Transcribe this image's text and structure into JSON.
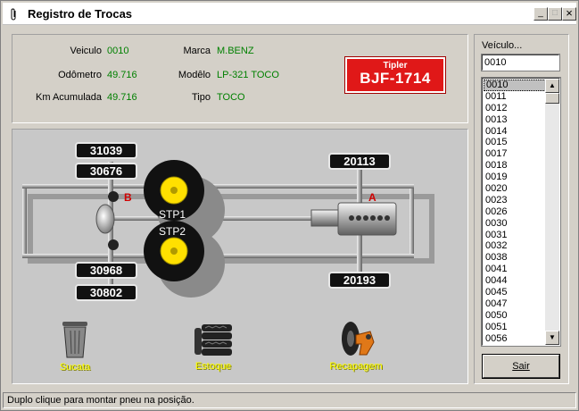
{
  "window": {
    "title": "Registro de Trocas",
    "minimize_glyph": "_",
    "maximize_glyph": "□",
    "close_glyph": "×"
  },
  "info": {
    "veiculo_label": "Veiculo",
    "veiculo_value": "0010",
    "odometro_label": "Odômetro",
    "odometro_value": "49.716",
    "km_label": "Km Acumulada",
    "km_value": "49.716",
    "marca_label": "Marca",
    "marca_value": "M.BENZ",
    "modelo_label": "Modêlo",
    "modelo_value": "LP-321 TOCO",
    "tipo_label": "Tipo",
    "tipo_value": "TOCO"
  },
  "plate": {
    "brand": "Tipler",
    "number": "BJF-1714"
  },
  "chassis": {
    "axle_b_label": "B",
    "axle_a_label": "A",
    "stp1_label": "STP1",
    "stp2_label": "STP2",
    "tires": {
      "left_top_outer": "31039",
      "left_top_inner": "30676",
      "left_bottom_inner": "30968",
      "left_bottom_outer": "30802",
      "right_top": "20113",
      "right_bottom": "20193"
    }
  },
  "actions": {
    "sucata": "Sucata",
    "estoque": "Estoque",
    "recapagem": "Recapagem"
  },
  "sidebar": {
    "label": "Veículo...",
    "input_value": "0010",
    "items": [
      "0010",
      "0011",
      "0012",
      "0013",
      "0014",
      "0015",
      "0017",
      "0018",
      "0019",
      "0020",
      "0023",
      "0026",
      "0030",
      "0031",
      "0032",
      "0038",
      "0041",
      "0044",
      "0045",
      "0047",
      "0050",
      "0051",
      "0056"
    ],
    "selected": "0010",
    "sair_button": "Sair"
  },
  "status": {
    "text": "Duplo clique para montar pneu na posição."
  },
  "colors": {
    "value_green": "#008000",
    "plate_red": "#e01818",
    "tire_yellow": "#ffe000",
    "label_yellow": "#ffff00"
  },
  "icons": {
    "app": "paperclip-icon",
    "sucata": "trash-can-icon",
    "estoque": "tire-stack-icon",
    "recapagem": "retread-machine-icon"
  }
}
